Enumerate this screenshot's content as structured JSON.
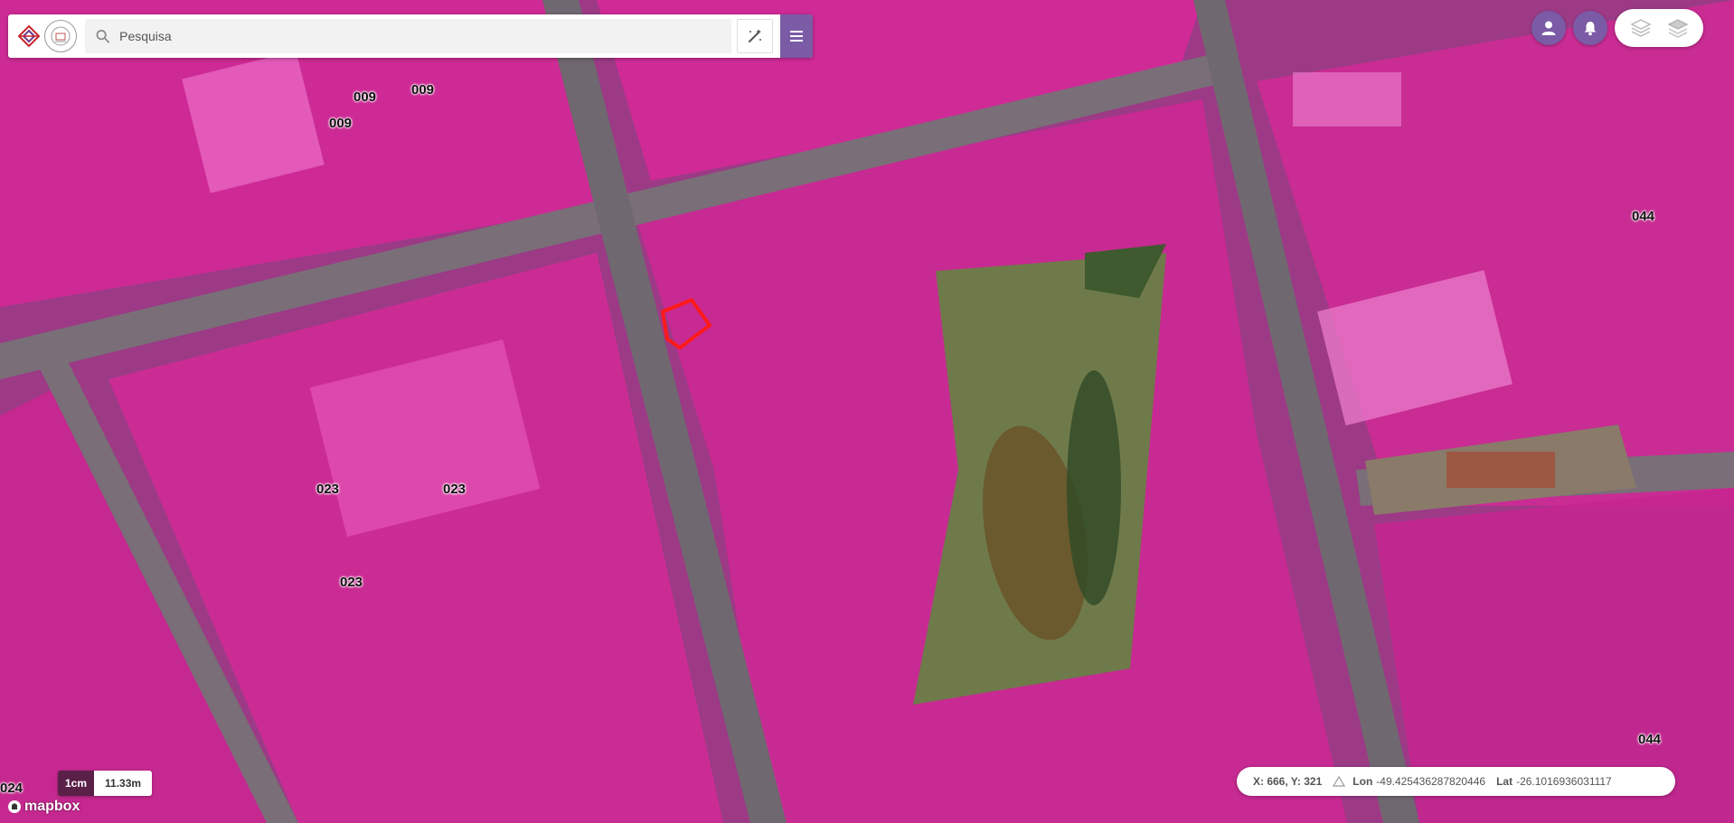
{
  "search": {
    "placeholder": "Pesquisa",
    "value": ""
  },
  "icons": {
    "logo": "municipal-logo-icon",
    "seal": "city-seal-icon",
    "search": "search-icon",
    "tools": "magic-wand-icon",
    "menu": "hamburger-menu-icon",
    "user": "user-icon",
    "notifications": "bell-icon",
    "layers_a": "layers-outline-icon",
    "layers_b": "layers-icon",
    "north": "north-arrow-icon"
  },
  "colors": {
    "accent": "#7b5aa6",
    "parcel_fill": "#e0209a",
    "selected_outline": "#ff1a1a"
  },
  "lots": [
    {
      "label": "009"
    },
    {
      "label": "009"
    },
    {
      "label": "009"
    },
    {
      "label": "023"
    },
    {
      "label": "023"
    },
    {
      "label": "023"
    },
    {
      "label": "044"
    },
    {
      "label": "044"
    },
    {
      "label": "024"
    }
  ],
  "scale": {
    "unit": "1cm",
    "value": "11.33m"
  },
  "attribution": {
    "brand": "mapbox"
  },
  "coords": {
    "xy": "X: 666, Y: 321",
    "lon_label": "Lon",
    "lon_value": "-49.425436287820446",
    "lat_label": "Lat",
    "lat_value": "-26.1016936031117"
  }
}
